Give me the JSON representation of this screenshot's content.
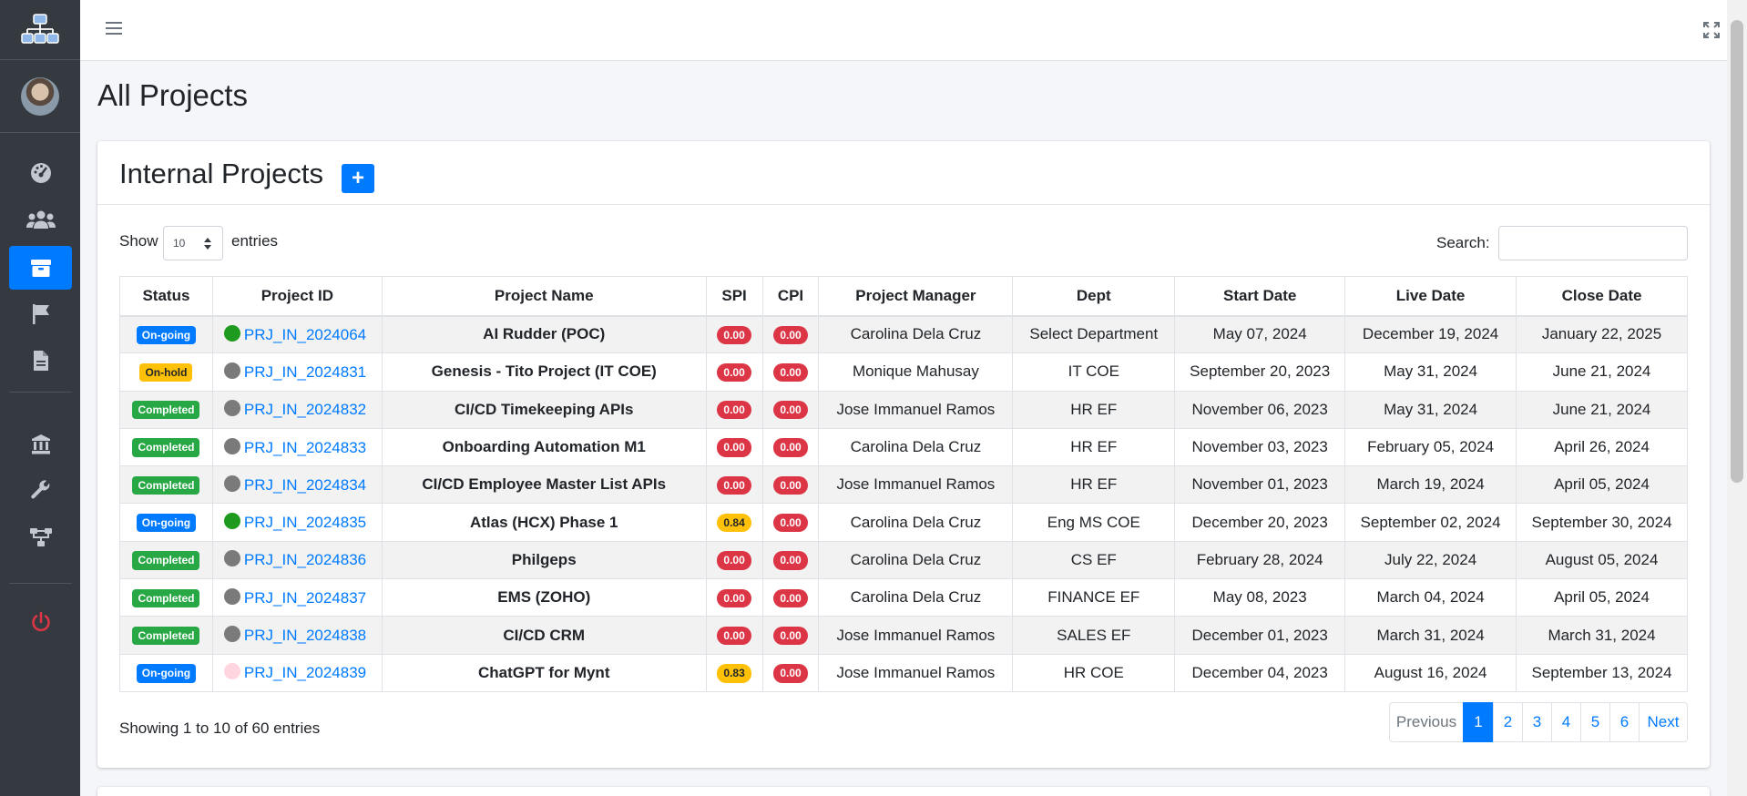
{
  "page": {
    "title": "All Projects"
  },
  "sidebar": {
    "items": [
      {
        "icon": "dashboard-icon"
      },
      {
        "icon": "users-icon"
      },
      {
        "icon": "projects-icon",
        "active": true
      },
      {
        "icon": "flag-icon"
      },
      {
        "icon": "document-icon"
      },
      {
        "icon": "bank-icon"
      },
      {
        "icon": "wrench-icon"
      },
      {
        "icon": "org-chart-icon"
      },
      {
        "icon": "power-icon"
      }
    ]
  },
  "card": {
    "title": "Internal Projects",
    "add_label": "+"
  },
  "controls": {
    "show_label": "Show",
    "entries_label": "entries",
    "page_length": "10",
    "search_label": "Search:",
    "search_value": ""
  },
  "table": {
    "columns": [
      "Status",
      "Project ID",
      "Project Name",
      "SPI",
      "CPI",
      "Project Manager",
      "Dept",
      "Start Date",
      "Live Date",
      "Close Date"
    ],
    "rows": [
      {
        "status": "On-going",
        "dot": "#1e9b1e",
        "id": "PRJ_IN_2024064",
        "name": "AI Rudder (POC)",
        "spi": "0.00",
        "cpi": "0.00",
        "manager": "Carolina Dela Cruz",
        "dept": "Select Department",
        "start": "May 07, 2024",
        "live": "December 19, 2024",
        "close": "January 22, 2025"
      },
      {
        "status": "On-hold",
        "dot": "#7a7a7a",
        "id": "PRJ_IN_2024831",
        "name": "Genesis - Tito Project (IT COE)",
        "spi": "0.00",
        "cpi": "0.00",
        "manager": "Monique Mahusay",
        "dept": "IT COE",
        "start": "September 20, 2023",
        "live": "May 31, 2024",
        "close": "June 21, 2024"
      },
      {
        "status": "Completed",
        "dot": "#7a7a7a",
        "id": "PRJ_IN_2024832",
        "name": "CI/CD Timekeeping APIs",
        "spi": "0.00",
        "cpi": "0.00",
        "manager": "Jose Immanuel Ramos",
        "dept": "HR EF",
        "start": "November 06, 2023",
        "live": "May 31, 2024",
        "close": "June 21, 2024"
      },
      {
        "status": "Completed",
        "dot": "#7a7a7a",
        "id": "PRJ_IN_2024833",
        "name": "Onboarding Automation M1",
        "spi": "0.00",
        "cpi": "0.00",
        "manager": "Carolina Dela Cruz",
        "dept": "HR EF",
        "start": "November 03, 2023",
        "live": "February 05, 2024",
        "close": "April 26, 2024"
      },
      {
        "status": "Completed",
        "dot": "#7a7a7a",
        "id": "PRJ_IN_2024834",
        "name": "CI/CD Employee Master List APIs",
        "spi": "0.00",
        "cpi": "0.00",
        "manager": "Jose Immanuel Ramos",
        "dept": "HR EF",
        "start": "November 01, 2023",
        "live": "March 19, 2024",
        "close": "April 05, 2024"
      },
      {
        "status": "On-going",
        "dot": "#1e9b1e",
        "id": "PRJ_IN_2024835",
        "name": "Atlas (HCX) Phase 1",
        "spi": "0.84",
        "cpi": "0.00",
        "manager": "Carolina Dela Cruz",
        "dept": "Eng MS COE",
        "start": "December 20, 2023",
        "live": "September 02, 2024",
        "close": "September 30, 2024"
      },
      {
        "status": "Completed",
        "dot": "#7a7a7a",
        "id": "PRJ_IN_2024836",
        "name": "Philgeps",
        "spi": "0.00",
        "cpi": "0.00",
        "manager": "Carolina Dela Cruz",
        "dept": "CS EF",
        "start": "February 28, 2024",
        "live": "July 22, 2024",
        "close": "August 05, 2024"
      },
      {
        "status": "Completed",
        "dot": "#7a7a7a",
        "id": "PRJ_IN_2024837",
        "name": "EMS (ZOHO)",
        "spi": "0.00",
        "cpi": "0.00",
        "manager": "Carolina Dela Cruz",
        "dept": "FINANCE EF",
        "start": "May 08, 2023",
        "live": "March 04, 2024",
        "close": "April 05, 2024"
      },
      {
        "status": "Completed",
        "dot": "#7a7a7a",
        "id": "PRJ_IN_2024838",
        "name": "CI/CD CRM",
        "spi": "0.00",
        "cpi": "0.00",
        "manager": "Jose Immanuel Ramos",
        "dept": "SALES EF",
        "start": "December 01, 2023",
        "live": "March 31, 2024",
        "close": "March 31, 2024"
      },
      {
        "status": "On-going",
        "dot": "#ffd6e0",
        "id": "PRJ_IN_2024839",
        "name": "ChatGPT for Mynt",
        "spi": "0.83",
        "cpi": "0.00",
        "manager": "Jose Immanuel Ramos",
        "dept": "HR COE",
        "start": "December 04, 2023",
        "live": "August 16, 2024",
        "close": "September 13, 2024"
      }
    ]
  },
  "footer": {
    "info": "Showing 1 to 10 of 60 entries",
    "pages": [
      "Previous",
      "1",
      "2",
      "3",
      "4",
      "5",
      "6",
      "Next"
    ],
    "active_page": "1"
  },
  "colors": {
    "primary": "#007bff",
    "success": "#28a745",
    "warning": "#ffc107",
    "danger": "#dc3545",
    "sidebar": "#343a40"
  }
}
